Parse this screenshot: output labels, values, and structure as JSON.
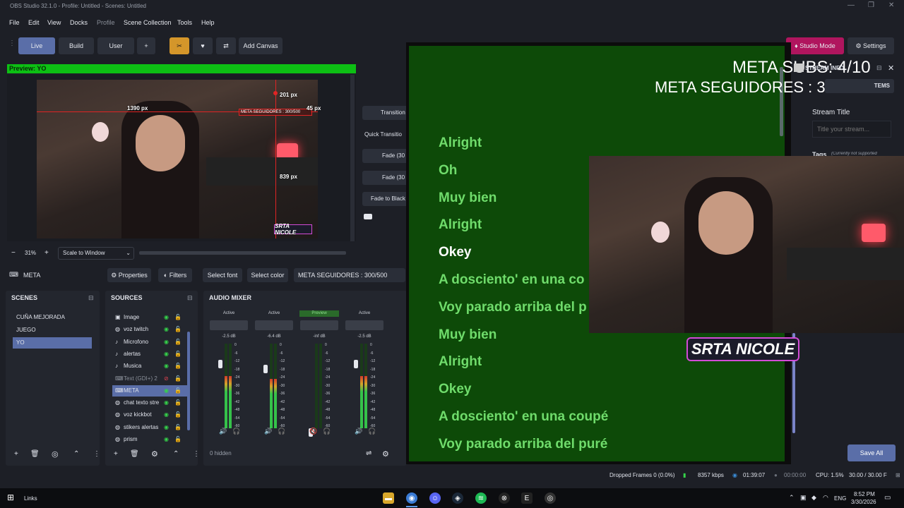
{
  "titlebar": {
    "title": "OBS Studio 32.1.0 - Profile: Untitled - Scenes: Untitled"
  },
  "menu": [
    "File",
    "Edit",
    "View",
    "Docks",
    "Profile",
    "Scene Collection",
    "Tools",
    "Help"
  ],
  "toolbar": {
    "live": "Live",
    "build": "Build",
    "user": "User",
    "add": "+",
    "add_canvas": "Add Canvas",
    "studio_mode": "Studio Mode",
    "settings": "Settings"
  },
  "preview": {
    "label": "Preview: YO",
    "guides": {
      "left": "1390 px",
      "top": "201 px",
      "right": "45 px",
      "bottom": "839 px"
    },
    "selected_source_text": "META SEGUIDORES : 300/500",
    "logo_text": "SRTA NICOLE"
  },
  "zoom": {
    "minus": "−",
    "value": "31%",
    "plus": "+",
    "mode": "Scale to Window"
  },
  "context_bar": {
    "source_name": "META",
    "properties": "Properties",
    "filters": "Filters",
    "select_font": "Select font",
    "select_color": "Select color",
    "text_value": "META SEGUIDORES : 300/500"
  },
  "transitions": {
    "transition": "Transition",
    "quick": "Quick Transitio",
    "fade1": "Fade (30",
    "fade2": "Fade (30",
    "fade_black": "Fade to Black"
  },
  "scenes": {
    "header": "SCENES",
    "items": [
      "CUÑA MEJORADA",
      "JUEGO",
      "YO"
    ],
    "selected": "YO"
  },
  "sources": {
    "header": "SOURCES",
    "items": [
      {
        "name": "Image",
        "icon": "image-icon"
      },
      {
        "name": "voz twitch",
        "icon": "globe-icon"
      },
      {
        "name": "Microfono",
        "icon": "mic-icon"
      },
      {
        "name": "alertas",
        "icon": "mic-icon"
      },
      {
        "name": "Musica",
        "icon": "mic-icon"
      },
      {
        "name": "Text (GDI+) 2",
        "icon": "text-icon"
      },
      {
        "name": "META",
        "icon": "text-icon"
      },
      {
        "name": "chat texto stre",
        "icon": "globe-icon"
      },
      {
        "name": "voz kickbot",
        "icon": "globe-icon"
      },
      {
        "name": "stikers alertas",
        "icon": "globe-icon"
      },
      {
        "name": "prism",
        "icon": "globe-icon"
      }
    ],
    "selected": "META",
    "hidden": "0 hidden"
  },
  "mixer": {
    "header": "AUDIO MIXER",
    "channels": [
      {
        "status": "Active",
        "db": "-2.5 dB",
        "level": 0.62
      },
      {
        "status": "Active",
        "db": "-6.4 dB",
        "level": 0.58
      },
      {
        "status": "Preview",
        "db": "-inf dB",
        "level": 0.0
      },
      {
        "status": "Active",
        "db": "-2.5 dB",
        "level": 0.62
      }
    ],
    "scale": [
      "0",
      "-6",
      "-12",
      "-18",
      "-24",
      "-30",
      "-36",
      "-42",
      "-48",
      "-54",
      "-60"
    ]
  },
  "overlay": {
    "meta_subs": "META SUBS: 4/10",
    "meta_seg": "META SEGUIDORES : 300/500",
    "lyrics": [
      "Alright",
      "Oh",
      "Muy bien",
      "Alright",
      "Okey",
      "A dosciento' en una co",
      "Voy parado arriba del p",
      "Muy bien",
      "Alright",
      "Okey",
      "A dosciento' en una coupé",
      "Voy parado arriba del puré"
    ],
    "active_line": 4,
    "logo_text": "SRTA NICOLE"
  },
  "right_panel": {
    "stream_info": "STREAM INFO",
    "items_label": "TEMS",
    "stream_title_label": "Stream Title",
    "stream_title_placeholder": "Title your stream...",
    "tags_label": "Tags",
    "tags_note": "(Currently not supported",
    "save_all": "Save All"
  },
  "status": {
    "dropped": "Dropped Frames 0 (0.0%)",
    "kbps": "8357 kbps",
    "stream_time": "01:39:07",
    "rec_time": "00:00:00",
    "cpu": "CPU: 1.5%",
    "fps": "30.00 / 30.00 F"
  },
  "taskbar": {
    "search": "Links",
    "lang": "ENG",
    "time": "8:52 PM",
    "date": "3/30/2026"
  },
  "colors": {
    "accent": "#5a6ea8",
    "preview_green": "#0dbf14",
    "overlay_green": "#0d4a08",
    "studio_mode": "#b0155e"
  }
}
